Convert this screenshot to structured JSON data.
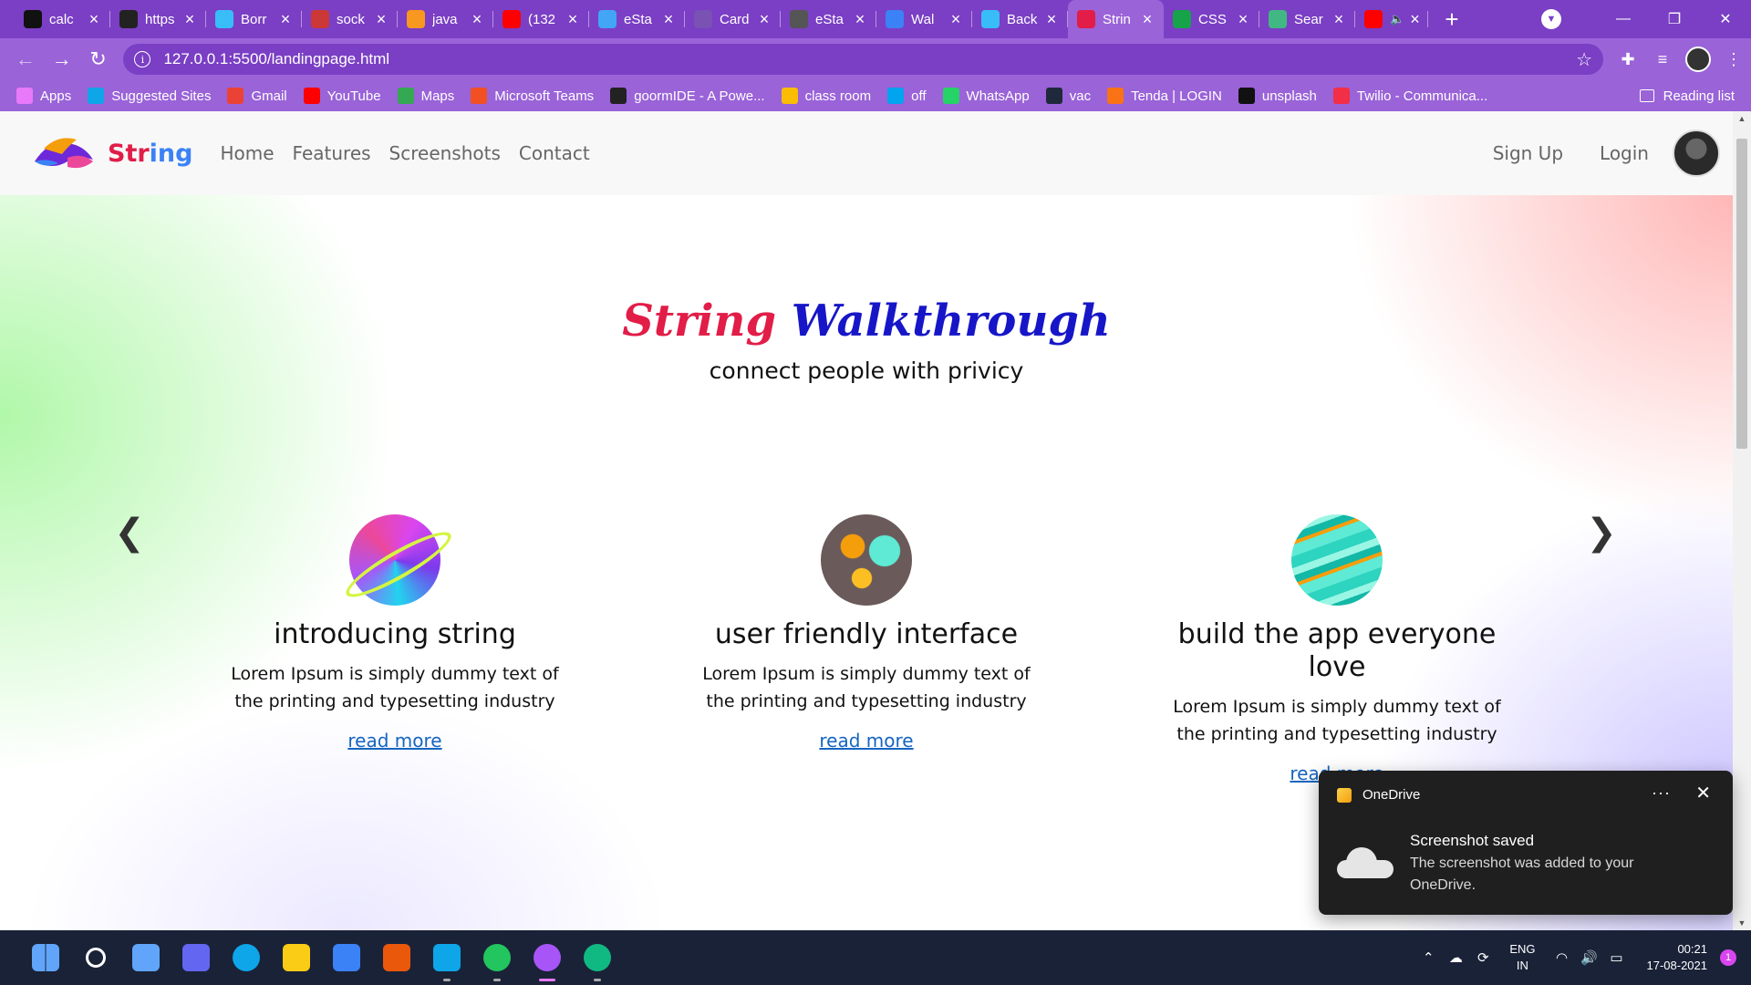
{
  "tabs": [
    {
      "title": "calc",
      "icon": "github-icon",
      "color": "#111111"
    },
    {
      "title": "https",
      "icon": "angular-icon",
      "color": "#222222"
    },
    {
      "title": "Borr",
      "icon": "tailwind-icon",
      "color": "#38bdf8"
    },
    {
      "title": "sock",
      "icon": "npm-icon",
      "color": "#cb3837"
    },
    {
      "title": "java",
      "icon": "java-icon",
      "color": "#f89820"
    },
    {
      "title": "(132",
      "icon": "youtube-icon",
      "color": "#ff0000"
    },
    {
      "title": "eSta",
      "icon": "flutter-icon",
      "color": "#42a5f5"
    },
    {
      "title": "Card",
      "icon": "bootstrap-icon",
      "color": "#7952b3"
    },
    {
      "title": "eSta",
      "icon": "b-icon",
      "color": "#555555"
    },
    {
      "title": "Wal",
      "icon": "c-icon",
      "color": "#3b82f6"
    },
    {
      "title": "Back",
      "icon": "tailwind-icon",
      "color": "#38bdf8"
    },
    {
      "title": "Strin",
      "icon": "string-logo-icon",
      "color": "#e11d48",
      "active": true
    },
    {
      "title": "CSS",
      "icon": "w-icon",
      "color": "#16a34a"
    },
    {
      "title": "Sear",
      "icon": "vue-icon",
      "color": "#41b883"
    },
    {
      "title": "",
      "icon": "youtube-icon",
      "color": "#ff0000",
      "audio": true
    }
  ],
  "address": {
    "url": "127.0.0.1:5500/landingpage.html"
  },
  "bookmarks": [
    {
      "label": "Apps",
      "color": "#e879f9"
    },
    {
      "label": "Suggested Sites",
      "color": "#0ea5e9"
    },
    {
      "label": "Gmail",
      "color": "#ea4335"
    },
    {
      "label": "YouTube",
      "color": "#ff0000"
    },
    {
      "label": "Maps",
      "color": "#34a853"
    },
    {
      "label": "Microsoft Teams",
      "color": "#f25022"
    },
    {
      "label": "goormIDE - A Powe...",
      "color": "#222222"
    },
    {
      "label": "class room",
      "color": "#fbbc04"
    },
    {
      "label": "off",
      "color": "#00a4ef"
    },
    {
      "label": "WhatsApp",
      "color": "#25d366"
    },
    {
      "label": "vac",
      "color": "#1e293b"
    },
    {
      "label": "Tenda | LOGIN",
      "color": "#f97316"
    },
    {
      "label": "unsplash",
      "color": "#111111"
    },
    {
      "label": "Twilio - Communica...",
      "color": "#f22f46"
    }
  ],
  "reading_list": "Reading list",
  "site": {
    "brand_a": "Str",
    "brand_b": "ing",
    "nav": [
      "Home",
      "Features",
      "Screenshots",
      "Contact"
    ],
    "signup": "Sign Up",
    "login": "Login"
  },
  "hero": {
    "title_a": "String",
    "title_b": "Walkthrough",
    "subtitle": "connect people with privicy",
    "prev": "❮",
    "next": "❯"
  },
  "cards": [
    {
      "title": "introducing string",
      "text": "Lorem Ipsum is simply dummy text of the printing and typesetting industry",
      "link": "read more"
    },
    {
      "title": "user friendly interface",
      "text": "Lorem Ipsum is simply dummy text of the printing and typesetting industry",
      "link": "read more"
    },
    {
      "title": "build the app everyone love",
      "text": "Lorem Ipsum is simply dummy text of the printing and typesetting industry",
      "link": "read more"
    }
  ],
  "carousel": {
    "slides": 3,
    "active_slide": 3
  },
  "toast": {
    "app": "OneDrive",
    "more": "···",
    "close": "✕",
    "title": "Screenshot saved",
    "message": "The screenshot was added to your OneDrive."
  },
  "taskbar": {
    "apps": [
      {
        "name": "start",
        "color": "#3b82f6"
      },
      {
        "name": "search",
        "color": "#ffffff"
      },
      {
        "name": "task-view",
        "color": "#60a5fa"
      },
      {
        "name": "teams-chat",
        "color": "#6366f1"
      },
      {
        "name": "edge",
        "color": "#0ea5e9"
      },
      {
        "name": "file-explorer",
        "color": "#facc15"
      },
      {
        "name": "mail",
        "color": "#3b82f6"
      },
      {
        "name": "office",
        "color": "#ea580c"
      },
      {
        "name": "vscode",
        "color": "#0ea5e9"
      },
      {
        "name": "chrome",
        "color": "#22c55e"
      },
      {
        "name": "chrome-profile",
        "color": "#a855f7",
        "active": true
      },
      {
        "name": "chrome-canary",
        "color": "#10b981"
      }
    ],
    "lang_top": "ENG",
    "lang_bottom": "IN",
    "time": "00:21",
    "date": "17-08-2021",
    "notifications": "1"
  }
}
